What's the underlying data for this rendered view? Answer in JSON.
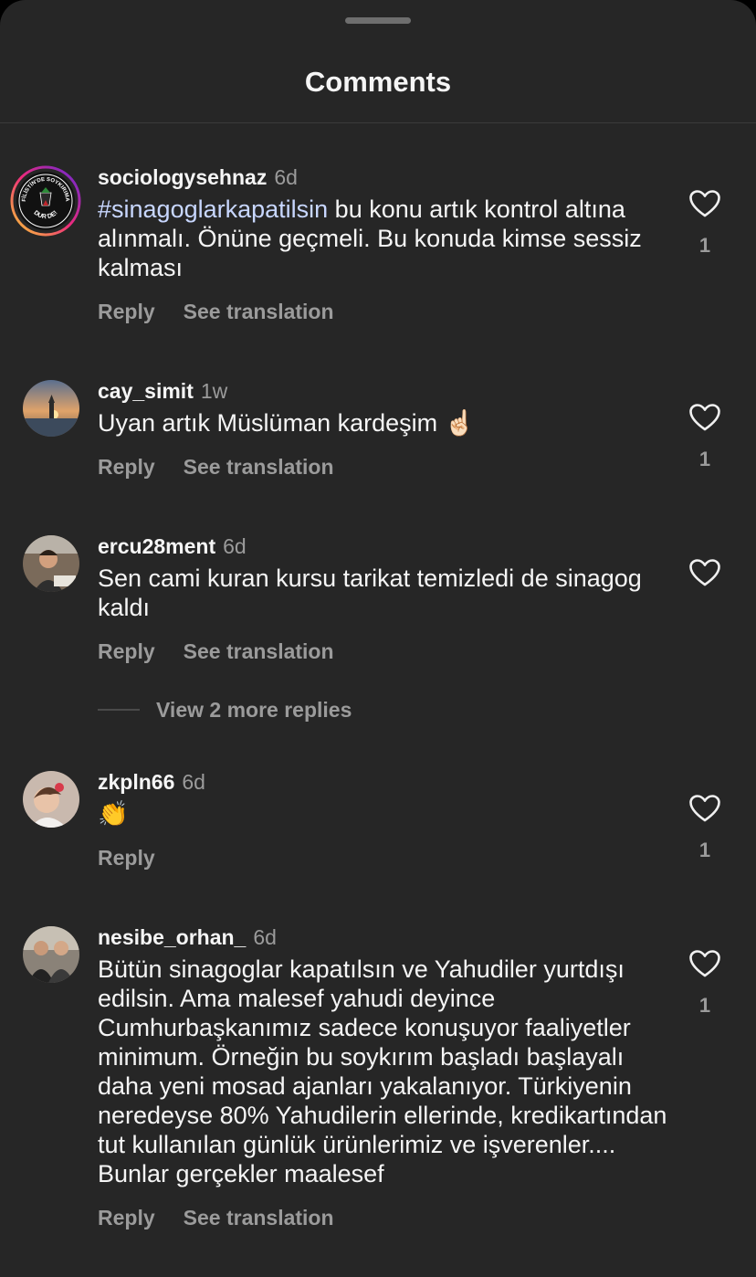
{
  "header": {
    "title": "Comments"
  },
  "comments": [
    {
      "username": "sociologysehnaz",
      "time": "6d",
      "hashtag": "#sinagoglarkapatilsin",
      "text": " bu konu artık kontrol altına alınmalı. Önüne geçmeli. Bu konuda kimse sessiz kalması",
      "reply": "Reply",
      "translate": "See translation",
      "likes": "1",
      "avatar_text_top": "FİLİSTİN'DE SOYKIRIMA",
      "avatar_text_bottom": "DUR DE!"
    },
    {
      "username": "cay_simit",
      "time": "1w",
      "text": "Uyan artık Müslüman kardeşim ☝🏻",
      "reply": "Reply",
      "translate": "See translation",
      "likes": "1"
    },
    {
      "username": "ercu28ment",
      "time": "6d",
      "text": "Sen cami kuran kursu tarikat temizledi de sinagog kaldı",
      "reply": "Reply",
      "translate": "See translation",
      "likes": "",
      "view_more": "View 2 more replies"
    },
    {
      "username": "zkpln66",
      "time": "6d",
      "text": "👏",
      "reply": "Reply",
      "likes": "1"
    },
    {
      "username": "nesibe_orhan_",
      "time": "6d",
      "text": "Bütün sinagoglar kapatılsın ve Yahudiler yurtdışı edilsin. Ama malesef yahudi deyince Cumhurbaşkanımız sadece konuşuyor faaliyetler minimum. Örneğin bu soykırım başladı başlayalı daha yeni mosad ajanları yakalanıyor. Türkiyenin neredeyse 80% Yahudilerin ellerinde, kredikartından tut kullanılan günlük ürünlerimiz ve işverenler.... Bunlar gerçekler maalesef",
      "reply": "Reply",
      "translate": "See translation",
      "likes": "1"
    }
  ],
  "colors": {
    "background": "#262626",
    "text": "#f5f5f5",
    "secondary": "#9b9b9b",
    "hashtag": "#c8d7ff",
    "story_ring_start": "#f9ce34",
    "story_ring_end": "#c13584"
  }
}
